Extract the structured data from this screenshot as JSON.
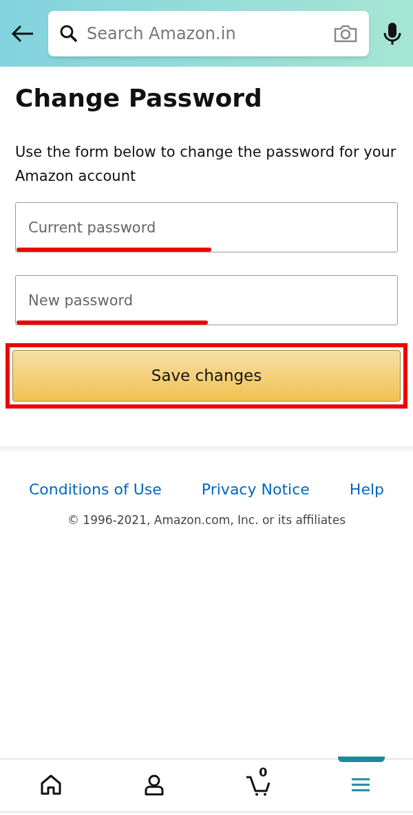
{
  "header": {
    "search": {
      "placeholder": "Search Amazon.in"
    }
  },
  "title": "Change Password",
  "description": "Use the form below to change the password for your Amazon account",
  "fields": [
    {
      "placeholder": "Current password",
      "underlined": true
    },
    {
      "placeholder": "New password",
      "underlined": true
    }
  ],
  "save_button": {
    "label": "Save changes",
    "highlighted": true
  },
  "footer": {
    "links": [
      "Conditions of Use",
      "Privacy Notice",
      "Help"
    ],
    "copyright": "© 1996-2021, Amazon.com, Inc. or its affiliates"
  },
  "bottom_nav": [
    {
      "kind": "home",
      "selected": false
    },
    {
      "kind": "account",
      "selected": false
    },
    {
      "kind": "cart",
      "badge": "0",
      "selected": false
    },
    {
      "kind": "menu",
      "selected": true
    }
  ]
}
